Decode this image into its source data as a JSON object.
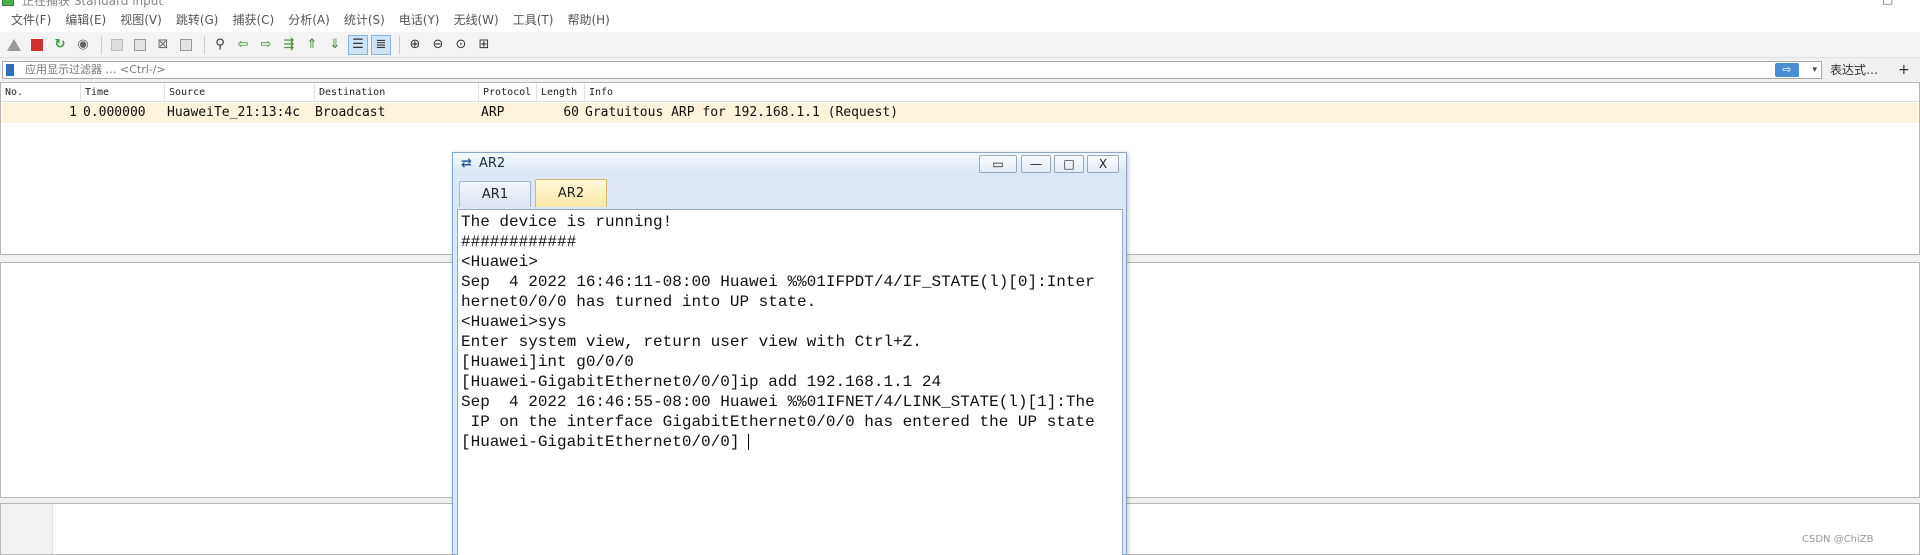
{
  "window": {
    "title": "正在捕获 Standard input",
    "controls": [
      "—",
      "□"
    ]
  },
  "menubar": {
    "items": [
      {
        "label": "文件(F)"
      },
      {
        "label": "编辑(E)"
      },
      {
        "label": "视图(V)"
      },
      {
        "label": "跳转(G)"
      },
      {
        "label": "捕获(C)"
      },
      {
        "label": "分析(A)"
      },
      {
        "label": "统计(S)"
      },
      {
        "label": "电话(Y)"
      },
      {
        "label": "无线(W)"
      },
      {
        "label": "工具(T)"
      },
      {
        "label": "帮助(H)"
      }
    ]
  },
  "toolbar": {
    "icons": [
      "shark-fin-start",
      "stop",
      "restart",
      "capture-options",
      "open-file",
      "save-file",
      "close-file",
      "reload-file",
      "find-packet",
      "go-back",
      "go-forward",
      "go-to-packet",
      "go-first-packet",
      "go-last-packet",
      "auto-scroll",
      "colorize",
      "zoom-in",
      "zoom-out",
      "zoom-normal",
      "resize-columns"
    ]
  },
  "filter": {
    "placeholder": "应用显示过滤器 … <Ctrl-/>",
    "apply_glyph": "⇨",
    "dropdown_glyph": "▾",
    "expression_label": "表达式…",
    "add_label": "+"
  },
  "packet_list": {
    "columns": [
      "No.",
      "Time",
      "Source",
      "Destination",
      "Protocol",
      "Length",
      "Info"
    ],
    "rows": [
      {
        "no": "1",
        "time": "0.000000",
        "source": "HuaweiTe_21:13:4c",
        "destination": "Broadcast",
        "protocol": "ARP",
        "length": "60",
        "info": "Gratuitous ARP for 192.168.1.1 (Request)",
        "row_color": "#fdf2dc"
      }
    ]
  },
  "dialog": {
    "title": "AR2",
    "buttons": {
      "restore": "▭",
      "minimize": "—",
      "maximize": "□",
      "close": "X"
    },
    "tabs": [
      {
        "label": "AR1",
        "active": false
      },
      {
        "label": "AR2",
        "active": true
      }
    ],
    "console_lines": [
      "The device is running!",
      "############",
      "<Huawei>",
      "Sep  4 2022 16:46:11-08:00 Huawei %%01IFPDT/4/IF_STATE(l)[0]:Inter",
      "hernet0/0/0 has turned into UP state.",
      "<Huawei>sys",
      "Enter system view, return user view with Ctrl+Z.",
      "[Huawei]int g0/0/0",
      "[Huawei-GigabitEthernet0/0/0]ip add 192.168.1.1 24",
      "Sep  4 2022 16:46:55-08:00 Huawei %%01IFNET/4/LINK_STATE(l)[1]:The",
      " IP on the interface GigabitEthernet0/0/0 has entered the UP state",
      "[Huawei-GigabitEthernet0/0/0]"
    ]
  },
  "watermark": "CSDN @ChiZB",
  "colors": {
    "selected_row": "#fdf2dc",
    "active_tab": "#fde8a6",
    "dialog_frame": "#dce8f6",
    "stop_button": "#d32f2f"
  }
}
